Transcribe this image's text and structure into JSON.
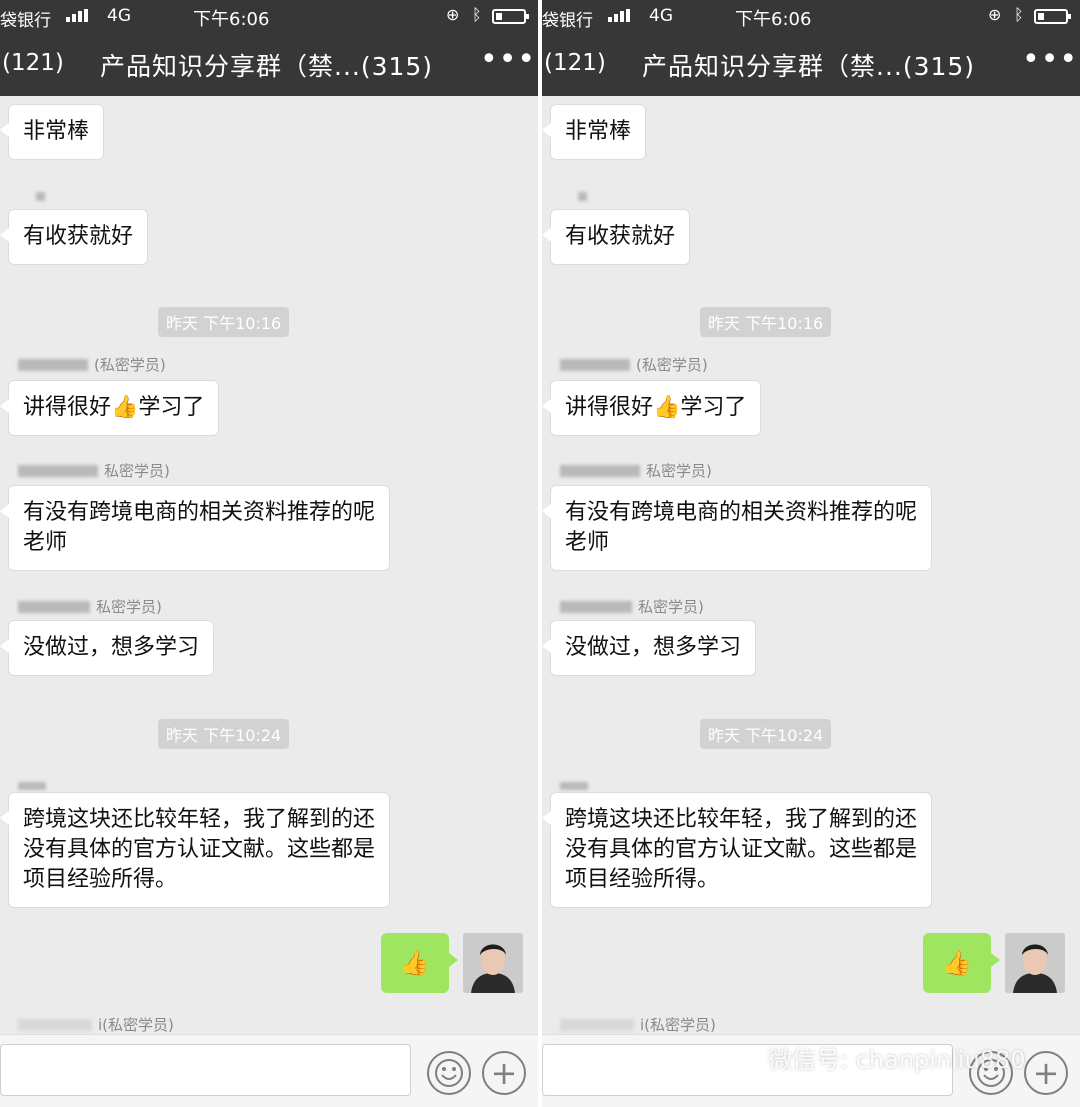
{
  "status": {
    "carrier": "袋银行",
    "network": "4G",
    "time": "下午6:06"
  },
  "nav": {
    "back_label": "(121)",
    "title": "产品知识分享群（禁...(315)",
    "more": "•••"
  },
  "chat": {
    "msg1": "非常棒",
    "msg2": "有收获就好",
    "time1": "昨天 下午10:16",
    "sender1": "(私密学员)",
    "msg3": "讲得很好👍学习了",
    "sender2": "私密学员)",
    "msg4_line1": "有没有跨境电商的相关资料推荐的呢",
    "msg4_line2": "老师",
    "sender3": "私密学员)",
    "msg5": "没做过，想多学习",
    "time2": "昨天 下午10:24",
    "msg6_line1": "跨境这块还比较年轻，我了解到的还",
    "msg6_line2": "没有具体的官方认证文献。这些都是",
    "msg6_line3": "项目经验所得。",
    "thumb": "👍",
    "sender4": "i(私密学员)"
  },
  "watermark": {
    "text": "微信号: chanpinliu880"
  },
  "icons": {
    "more": "more-icon",
    "emoji": "emoji-icon",
    "plus": "plus-icon",
    "bluetooth": "bluetooth-icon",
    "battery": "battery-icon"
  },
  "colors": {
    "topbar": "#373737",
    "chat_bg": "#ebebeb",
    "self_bubble": "#9fe55f",
    "time_chip": "#d2d2d2"
  }
}
